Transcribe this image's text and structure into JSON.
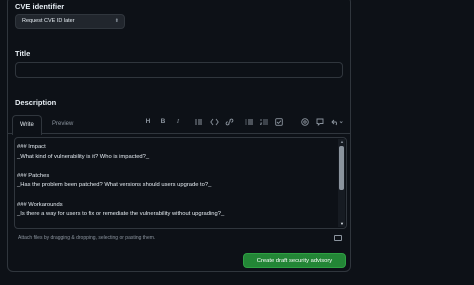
{
  "cve": {
    "label": "CVE identifier",
    "selected": "Request CVE ID later",
    "caret_icon": "chevron-updown-icon"
  },
  "title_field": {
    "label": "Title",
    "value": ""
  },
  "description": {
    "label": "Description",
    "tabs": [
      "Write",
      "Preview"
    ],
    "toolbar": [
      "heading-icon",
      "bold-icon",
      "italic-icon",
      "quote-icon",
      "code-icon",
      "link-icon",
      "unordered-list-icon",
      "ordered-list-icon",
      "task-list-icon",
      "mention-icon",
      "reference-icon",
      "undo-icon"
    ],
    "toolbar_glyphs": {
      "heading": "H",
      "bold": "B",
      "italic": "I"
    },
    "lines": [
      "### Impact",
      "_What kind of vulnerability is it? Who is impacted?_",
      "",
      "### Patches",
      "_Has the problem been patched? What versions should users upgrade to?_",
      "",
      "### Workarounds",
      "_Is there a way for users to fix or remediate the vulnerability without upgrading?_"
    ],
    "attach_text": "Attach files by dragging & dropping, selecting or pasting them."
  },
  "submit": {
    "label": "Create draft security advisory",
    "color": "#238636"
  }
}
